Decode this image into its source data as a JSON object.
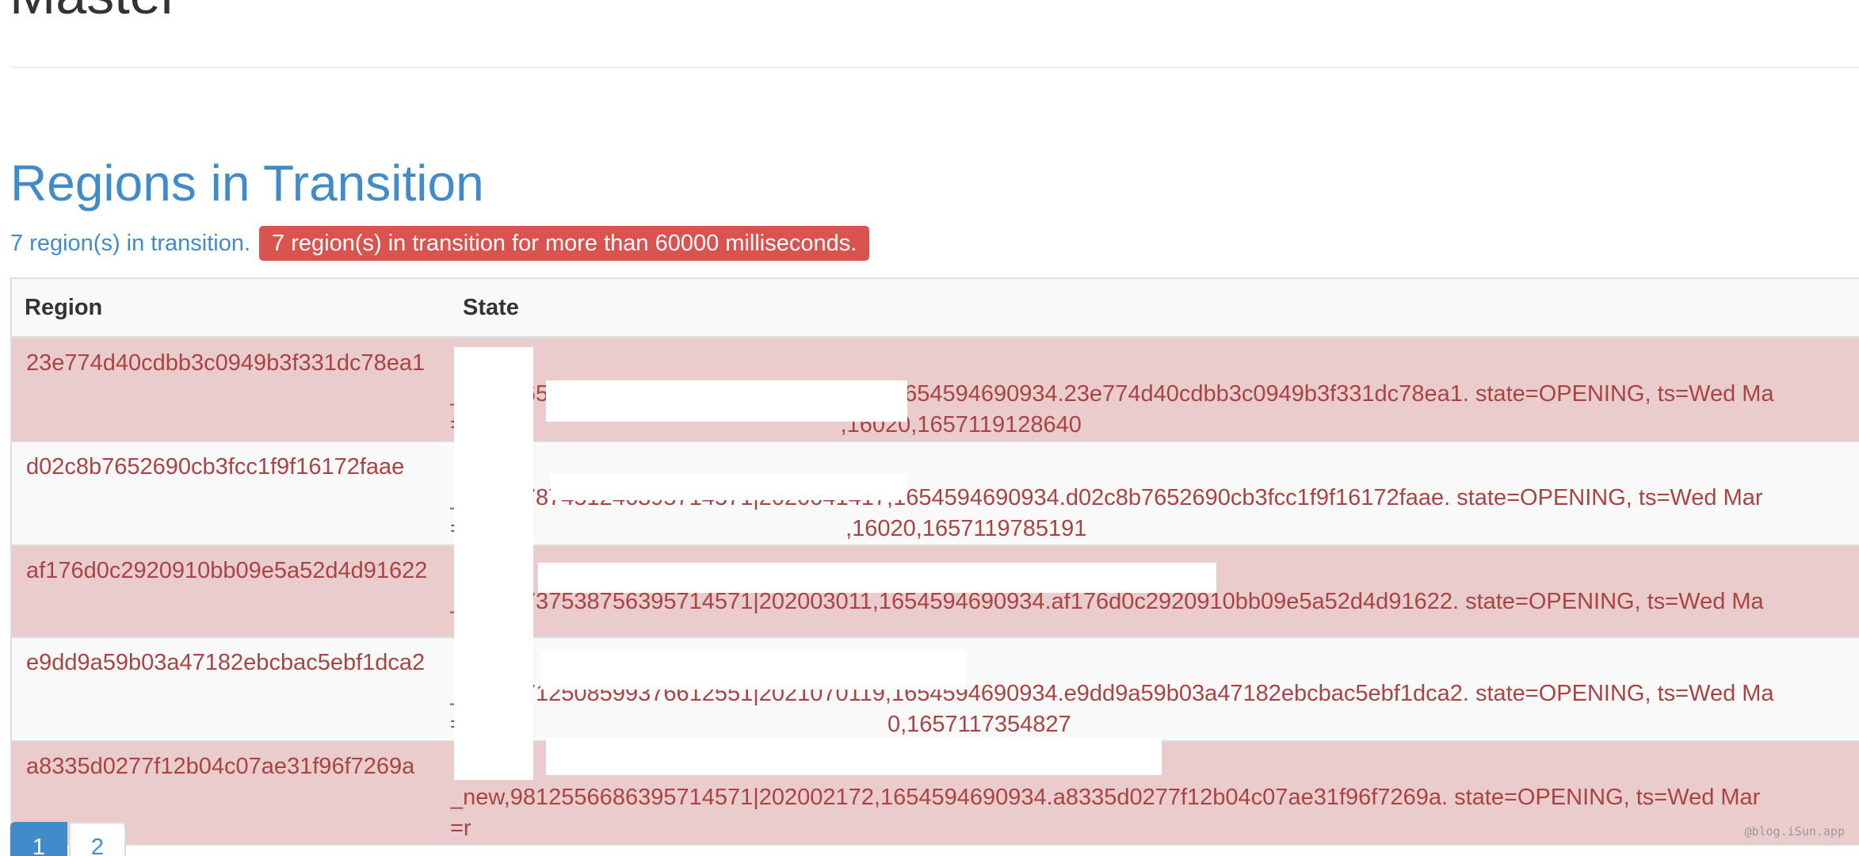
{
  "header": {
    "title": "Master"
  },
  "rit": {
    "title": "Regions in Transition",
    "count_text": "7 region(s) in transition.",
    "alert_text": "7 region(s) in transition for more than 60000 milliseconds."
  },
  "table": {
    "headers": [
      "Region",
      "State"
    ],
    "rows": [
      {
        "region": "23e774d40cdbb3c0949b3f331dc78ea1",
        "state_line1": "_new,9650011866399553671|2021072604,1654594690934.23e774d40cdbb3c0949b3f331dc78ea1. state=OPENING, ts=Wed Ma",
        "state_line2": "=r",
        "state_line2_tail": ",16020,1657119128640"
      },
      {
        "region": "d02c8b7652690cb3fcc1f9f16172faae",
        "state_line1": "_new,9787451246395714571|2020041417,1654594690934.d02c8b7652690cb3fcc1f9f16172faae. state=OPENING, ts=Wed Mar",
        "state_line2": "=n",
        "state_line2_tail": ",16020,1657119785191"
      },
      {
        "region": "af176d0c2920910bb09e5a52d4d91622",
        "state_line1": "_new,9737538756395714571|202003011,1654594690934.af176d0c2920910bb09e5a52d4d91622. state=OPENING, ts=Wed Ma",
        "state_line2": "",
        "state_line2_tail": ""
      },
      {
        "region": "e9dd9a59b03a47182ebcbac5ebf1dca2",
        "state_line1": "_new,9712508599376612551|2021070119,1654594690934.e9dd9a59b03a47182ebcbac5ebf1dca2. state=OPENING, ts=Wed Ma",
        "state_line2": "=",
        "state_line2_tail": "0,1657117354827"
      },
      {
        "region": "a8335d0277f12b04c07ae31f96f7269a",
        "state_line1": "_new,9812556686395714571|202002172,1654594690934.a8335d0277f12b04c07ae31f96f7269a. state=OPENING, ts=Wed Mar",
        "state_line2": "=r",
        "state_line2_tail": ""
      }
    ]
  },
  "pagination": {
    "pages": [
      "1",
      "2"
    ],
    "active": "1"
  },
  "watermark": "@blog.iSun.app",
  "colors": {
    "link": "#428bca",
    "danger": "#d9534f",
    "danger_row": "#ebcccc",
    "danger_text": "#a94442"
  }
}
